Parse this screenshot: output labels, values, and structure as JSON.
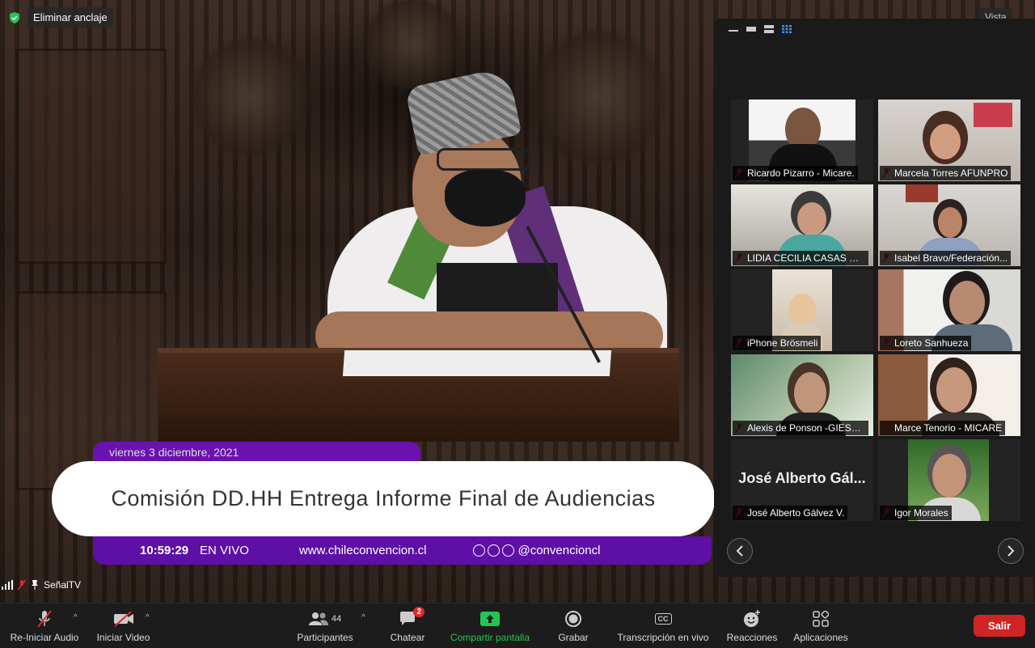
{
  "pin": {
    "label": "Eliminar anclaje"
  },
  "view_menu": {
    "label": "Vista"
  },
  "stream": {
    "date": "viernes 3 diciembre, 2021",
    "title": "Comisión DD.HH Entrega Informe Final de Audiencias",
    "time": "10:59:29",
    "live": "EN VIVO",
    "website": "www.chileconvencion.cl",
    "social": "@convencioncl"
  },
  "participants": [
    {
      "name": "Ricardo Pizarro - Micare.",
      "muted": true
    },
    {
      "name": "Marcela Torres AFUNPRO",
      "muted": true
    },
    {
      "name": "LIDIA CECILIA CASAS BE...",
      "muted": true
    },
    {
      "name": "Isabel Bravo/Federación...",
      "muted": true
    },
    {
      "name": "iPhone Brösmeli",
      "muted": true
    },
    {
      "name": "Loreto Sanhueza",
      "muted": true
    },
    {
      "name": "Alexis de Ponson -GIESCR",
      "muted": true
    },
    {
      "name": "Marce Tenorio - MICARE",
      "muted": true
    },
    {
      "name": "José Alberto Gálvez V.",
      "muted": true,
      "video_off": true,
      "display_name": "José Alberto Gál..."
    },
    {
      "name": "Igor Morales",
      "muted": true
    }
  ],
  "active_speaker": {
    "name": "SeñalTV"
  },
  "toolbar": {
    "audio": "Re-Iniciar Audio",
    "video": "Iniciar Video",
    "participants": "Participantes",
    "participants_count": "44",
    "chat": "Chatear",
    "chat_badge": "2",
    "share": "Compartir pantalla",
    "record": "Grabar",
    "captions": "Transcripción en vivo",
    "captions_icon": "CC",
    "reactions": "Reacciones",
    "apps": "Aplicaciones",
    "leave": "Salir"
  },
  "colors": {
    "accent_green": "#23c552",
    "leave_red": "#d02424",
    "banner_purple": "#6a12b0",
    "muted_red": "#e02828"
  }
}
